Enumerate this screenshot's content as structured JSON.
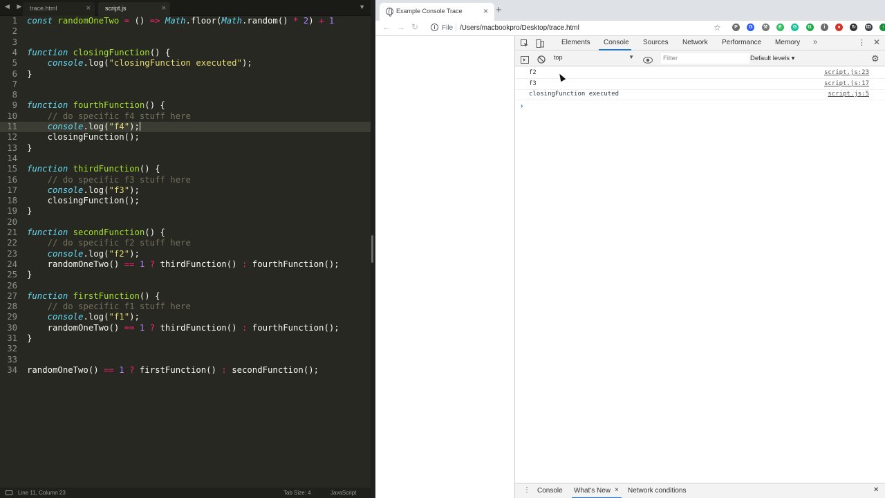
{
  "editor": {
    "tabs": [
      {
        "label": "trace.html",
        "close": "×"
      },
      {
        "label": "script.js",
        "close": "×"
      }
    ],
    "nav_arrows": "◀ ▶",
    "tab_menu": "▼",
    "lines": [
      {
        "n": "1"
      },
      {
        "n": "2"
      },
      {
        "n": "3"
      },
      {
        "n": "4"
      },
      {
        "n": "5"
      },
      {
        "n": "6"
      },
      {
        "n": "7"
      },
      {
        "n": "8"
      },
      {
        "n": "9"
      },
      {
        "n": "10"
      },
      {
        "n": "11"
      },
      {
        "n": "12"
      },
      {
        "n": "13"
      },
      {
        "n": "14"
      },
      {
        "n": "15"
      },
      {
        "n": "16"
      },
      {
        "n": "17"
      },
      {
        "n": "18"
      },
      {
        "n": "19"
      },
      {
        "n": "20"
      },
      {
        "n": "21"
      },
      {
        "n": "22"
      },
      {
        "n": "23"
      },
      {
        "n": "24"
      },
      {
        "n": "25"
      },
      {
        "n": "26"
      },
      {
        "n": "27"
      },
      {
        "n": "28"
      },
      {
        "n": "29"
      },
      {
        "n": "30"
      },
      {
        "n": "31"
      },
      {
        "n": "32"
      },
      {
        "n": "33"
      },
      {
        "n": "34"
      }
    ],
    "code": [
      [
        [
          "kw",
          "const "
        ],
        [
          "fn",
          "randomOneTwo"
        ],
        [
          "op",
          " = "
        ],
        [
          "",
          "() "
        ],
        [
          "op",
          "=> "
        ],
        [
          "it",
          "Math"
        ],
        [
          "",
          ".floor("
        ],
        [
          "it",
          "Math"
        ],
        [
          "",
          ".random() "
        ],
        [
          "op",
          "* "
        ],
        [
          "num",
          "2"
        ],
        [
          "",
          ") "
        ],
        [
          "op",
          "+ "
        ],
        [
          "num",
          "1"
        ]
      ],
      [],
      [],
      [
        [
          "kw",
          "function "
        ],
        [
          "fn",
          "closingFunction"
        ],
        [
          "",
          "() {"
        ]
      ],
      [
        [
          "",
          "    "
        ],
        [
          "it",
          "console"
        ],
        [
          "",
          ".log("
        ],
        [
          "str",
          "\"closingFunction executed\""
        ],
        [
          "",
          ");"
        ]
      ],
      [
        [
          "",
          "}"
        ]
      ],
      [],
      [],
      [
        [
          "kw",
          "function "
        ],
        [
          "fn",
          "fourthFunction"
        ],
        [
          "",
          "() {"
        ]
      ],
      [
        [
          "cmt",
          "    // do specific f4 stuff here"
        ]
      ],
      [
        [
          "",
          "    "
        ],
        [
          "it",
          "console"
        ],
        [
          "",
          ".log("
        ],
        [
          "str",
          "\"f4\""
        ],
        [
          "",
          ");"
        ],
        [
          "cursor",
          ""
        ]
      ],
      [
        [
          "",
          "    closingFunction();"
        ]
      ],
      [
        [
          "",
          "}"
        ]
      ],
      [],
      [
        [
          "kw",
          "function "
        ],
        [
          "fn",
          "thirdFunction"
        ],
        [
          "",
          "() {"
        ]
      ],
      [
        [
          "cmt",
          "    // do specific f3 stuff here"
        ]
      ],
      [
        [
          "",
          "    "
        ],
        [
          "it",
          "console"
        ],
        [
          "",
          ".log("
        ],
        [
          "str",
          "\"f3\""
        ],
        [
          "",
          ");"
        ]
      ],
      [
        [
          "",
          "    closingFunction();"
        ]
      ],
      [
        [
          "",
          "}"
        ]
      ],
      [],
      [
        [
          "kw",
          "function "
        ],
        [
          "fn",
          "secondFunction"
        ],
        [
          "",
          "() {"
        ]
      ],
      [
        [
          "cmt",
          "    // do specific f2 stuff here"
        ]
      ],
      [
        [
          "",
          "    "
        ],
        [
          "it",
          "console"
        ],
        [
          "",
          ".log("
        ],
        [
          "str",
          "\"f2\""
        ],
        [
          "",
          ");"
        ]
      ],
      [
        [
          "",
          "    randomOneTwo() "
        ],
        [
          "op",
          "== "
        ],
        [
          "num",
          "1 "
        ],
        [
          "op",
          "? "
        ],
        [
          "",
          "thirdFunction() "
        ],
        [
          "op",
          ": "
        ],
        [
          "",
          "fourthFunction();"
        ]
      ],
      [
        [
          "",
          "}"
        ]
      ],
      [],
      [
        [
          "kw",
          "function "
        ],
        [
          "fn",
          "firstFunction"
        ],
        [
          "",
          "() {"
        ]
      ],
      [
        [
          "cmt",
          "    // do specific f1 stuff here"
        ]
      ],
      [
        [
          "",
          "    "
        ],
        [
          "it",
          "console"
        ],
        [
          "",
          ".log("
        ],
        [
          "str",
          "\"f1\""
        ],
        [
          "",
          ");"
        ]
      ],
      [
        [
          "",
          "    randomOneTwo() "
        ],
        [
          "op",
          "== "
        ],
        [
          "num",
          "1 "
        ],
        [
          "op",
          "? "
        ],
        [
          "",
          "thirdFunction() "
        ],
        [
          "op",
          ": "
        ],
        [
          "",
          "fourthFunction();"
        ]
      ],
      [
        [
          "",
          "}"
        ]
      ],
      [],
      [],
      [
        [
          "",
          "randomOneTwo() "
        ],
        [
          "op",
          "== "
        ],
        [
          "num",
          "1 "
        ],
        [
          "op",
          "? "
        ],
        [
          "",
          "firstFunction() "
        ],
        [
          "op",
          ": "
        ],
        [
          "",
          "secondFunction();"
        ]
      ]
    ],
    "status": {
      "position": "Line 11, Column 23",
      "tab_size": "Tab Size: 4",
      "language": "JavaScript"
    }
  },
  "browser": {
    "tab_title": "Example Console Trace",
    "tab_close": "×",
    "new_tab": "+",
    "back": "←",
    "forward": "→",
    "reload": "↻",
    "info": "i",
    "scheme": "File",
    "url": "/Users/macbookpro/Desktop/trace.html",
    "star": "☆",
    "extensions": [
      {
        "name": "pinterest-icon",
        "color": "#6b6b6b",
        "glyph": "P"
      },
      {
        "name": "blue-extension-icon",
        "color": "#2e5cff",
        "glyph": "G"
      },
      {
        "name": "tools-extension-icon",
        "color": "#777777",
        "glyph": "⚒"
      },
      {
        "name": "evernote-icon",
        "color": "#2dbe60",
        "glyph": "E"
      },
      {
        "name": "grammarly-icon",
        "color": "#15c39a",
        "glyph": "G"
      },
      {
        "name": "green-extension-icon",
        "color": "#1faa4a",
        "glyph": "G"
      },
      {
        "name": "info-extension-icon",
        "color": "#6b6b6b",
        "glyph": "i"
      },
      {
        "name": "red-extension-icon",
        "color": "#d93025",
        "glyph": "●"
      },
      {
        "name": "sync-extension-icon",
        "color": "#333333",
        "glyph": "↻"
      },
      {
        "name": "profile-avatar-icon",
        "color": "#3c4043",
        "glyph": "ID"
      },
      {
        "name": "green-menu-icon",
        "color": "#1e8e3e",
        "glyph": "↑"
      }
    ]
  },
  "devtools": {
    "tabs": [
      "Elements",
      "Console",
      "Sources",
      "Network",
      "Performance",
      "Memory"
    ],
    "more": "»",
    "kebab": "⋮",
    "close": "✕",
    "context": "top",
    "caret": "▼",
    "filter_placeholder": "Filter",
    "levels": "Default levels ▾",
    "gear": "⚙",
    "messages": [
      {
        "text": "f2",
        "src": "script.js:23"
      },
      {
        "text": "f3",
        "src": "script.js:17"
      },
      {
        "text": "closingFunction executed",
        "src": "script.js:5"
      }
    ],
    "prompt": "›",
    "drawer": {
      "kebab": "⋮",
      "tabs": [
        "Console",
        "What's New",
        "Network conditions"
      ],
      "tab_close": "×",
      "close": "✕"
    }
  }
}
